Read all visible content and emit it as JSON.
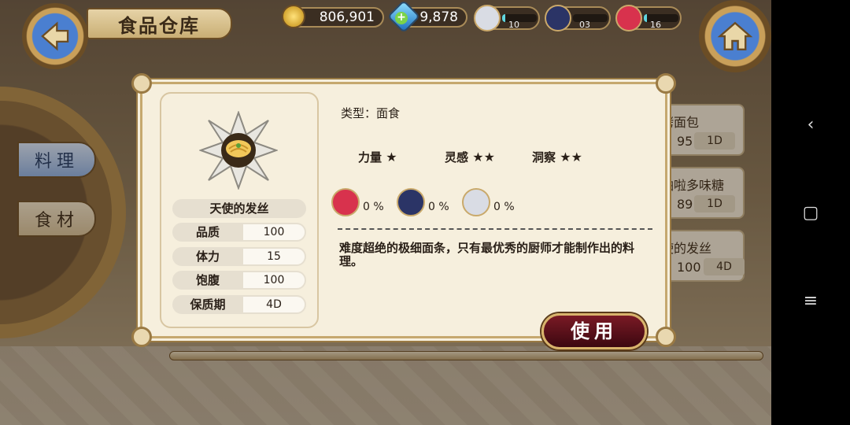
{
  "header": {
    "title": "食品仓库",
    "gold": "806,901",
    "gems": "9,878",
    "characters": [
      {
        "level": "10",
        "color": "#d9dce4",
        "bar": 0.1
      },
      {
        "level": "03",
        "color": "#2b3466",
        "bar": 0.0
      },
      {
        "level": "16",
        "color": "#d8324d",
        "bar": 0.1
      }
    ]
  },
  "side_menu": {
    "cook": "料理",
    "ingredients": "食材"
  },
  "list": [
    {
      "name": "烤面包",
      "qty": "95",
      "days": "1D"
    },
    {
      "name": "啪啦多味糖",
      "qty": "89",
      "days": "1D"
    },
    {
      "name": "使的发丝",
      "qty": "100",
      "days": "4D"
    }
  ],
  "dialog": {
    "item_name": "天使的发丝",
    "stats": [
      {
        "label": "品质",
        "value": "100"
      },
      {
        "label": "体力",
        "value": "15"
      },
      {
        "label": "饱腹",
        "value": "100"
      },
      {
        "label": "保质期",
        "value": "4D"
      }
    ],
    "type_line": "类型：面食",
    "attributes": [
      {
        "label": "力量",
        "stars": "★"
      },
      {
        "label": "灵感",
        "stars": "★★"
      },
      {
        "label": "洞察",
        "stars": "★★"
      }
    ],
    "affinity": [
      {
        "value": "0 %",
        "color": "#d8324d"
      },
      {
        "value": "0 %",
        "color": "#2b3466"
      },
      {
        "value": "0 %",
        "color": "#d9dce4"
      }
    ],
    "description": "难度超绝的极细面条，只有最优秀的厨师才能制作出的料理。",
    "use_button": "使用"
  },
  "system_nav": {
    "back": "‹",
    "home": "▢",
    "menu": "≡"
  }
}
